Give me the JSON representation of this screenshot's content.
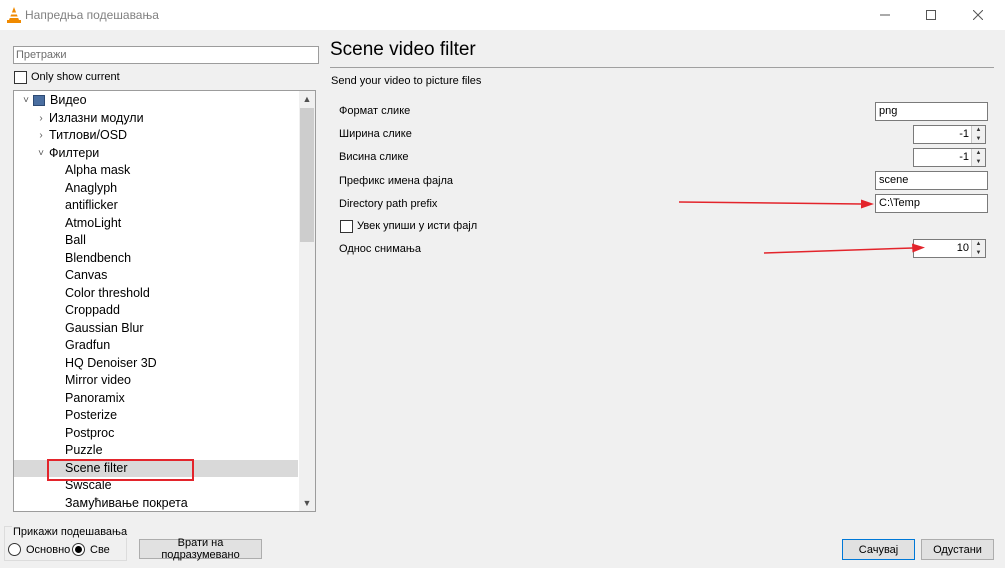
{
  "window": {
    "title": "Напредња подешавања",
    "minimize_icon": "minimize-icon",
    "maximize_icon": "maximize-icon",
    "close_icon": "close-icon"
  },
  "left": {
    "search_placeholder": "Претражи",
    "only_show_current_label": "Only show current",
    "only_show_current_checked": false,
    "tree": [
      {
        "label": "Видео",
        "level": 0,
        "expanded": true,
        "has_icon": true
      },
      {
        "label": "Излазни модули",
        "level": 1,
        "expanded": false
      },
      {
        "label": "Титлови/OSD",
        "level": 1,
        "expanded": false
      },
      {
        "label": "Филтери",
        "level": 1,
        "expanded": true
      },
      {
        "label": "Alpha mask",
        "level": 2
      },
      {
        "label": "Anaglyph",
        "level": 2
      },
      {
        "label": "antiflicker",
        "level": 2
      },
      {
        "label": "AtmoLight",
        "level": 2
      },
      {
        "label": "Ball",
        "level": 2
      },
      {
        "label": "Blendbench",
        "level": 2
      },
      {
        "label": "Canvas",
        "level": 2
      },
      {
        "label": "Color threshold",
        "level": 2
      },
      {
        "label": "Croppadd",
        "level": 2
      },
      {
        "label": "Gaussian Blur",
        "level": 2
      },
      {
        "label": "Gradfun",
        "level": 2
      },
      {
        "label": "HQ Denoiser 3D",
        "level": 2
      },
      {
        "label": "Mirror video",
        "level": 2
      },
      {
        "label": "Panoramix",
        "level": 2
      },
      {
        "label": "Posterize",
        "level": 2
      },
      {
        "label": "Postproc",
        "level": 2
      },
      {
        "label": "Puzzle",
        "level": 2
      },
      {
        "label": "Scene filter",
        "level": 2,
        "selected": true
      },
      {
        "label": "Swscale",
        "level": 2
      },
      {
        "label": "Замућивање покрета",
        "level": 2
      }
    ]
  },
  "show_settings": {
    "legend": "Прикажи подешавања",
    "basic_label": "Основно",
    "all_label": "Све",
    "selected": "all"
  },
  "buttons": {
    "reset": "Врати на подразумевано",
    "save": "Сачувај",
    "cancel": "Одустани"
  },
  "panel": {
    "title": "Scene video filter",
    "subtitle": "Send your video to picture files",
    "fields": {
      "image_format": {
        "label": "Формат слике",
        "value": "png"
      },
      "image_width": {
        "label": "Ширина слике",
        "value": "-1"
      },
      "image_height": {
        "label": "Висина слике",
        "value": "-1"
      },
      "filename_prefix": {
        "label": "Префикс имена фајла",
        "value": "scene"
      },
      "directory_path": {
        "label": "Directory path prefix",
        "value": "C:\\Temp"
      },
      "always_same_file": {
        "label": "Увек упиши у исти фајл",
        "checked": false
      },
      "recording_ratio": {
        "label": "Однос снимања",
        "value": "10"
      }
    }
  },
  "colors": {
    "annotation_red": "#e3242b",
    "selection": "#d9d9d9",
    "save_border": "#0078d7"
  }
}
